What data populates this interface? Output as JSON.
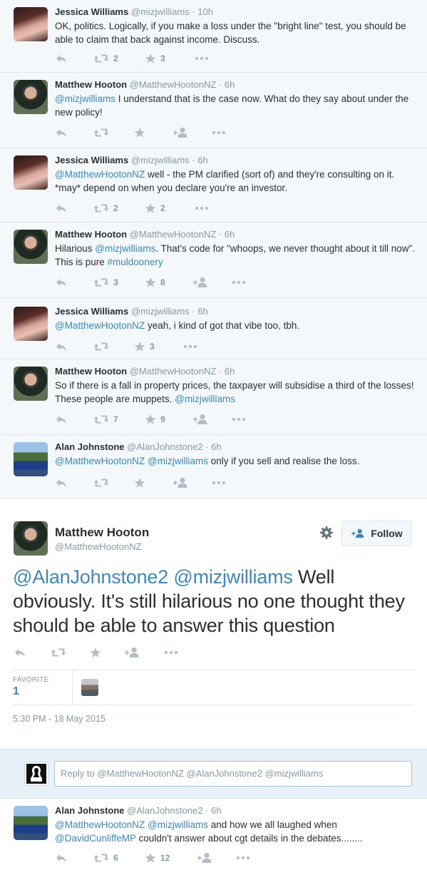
{
  "tweets": [
    {
      "fullname": "Jessica Williams",
      "handle": "@mizjwilliams",
      "time": "· 10h",
      "text_parts": [
        "OK, politics. Logically, if you make a loss under the \"bright line\" test, you should be able to claim that back against income. Discuss."
      ],
      "retweets": "2",
      "favorites": "3",
      "has_follow": false
    },
    {
      "fullname": "Matthew Hooton",
      "handle": "@MatthewHootonNZ",
      "time": "· 6h",
      "mention1": "@mizjwilliams",
      "text": " I understand that is the case now. What do they say about under the new policy!",
      "retweets": "",
      "favorites": "",
      "has_follow": true
    },
    {
      "fullname": "Jessica Williams",
      "handle": "@mizjwilliams",
      "time": "· 6h",
      "mention1": "@MatthewHootonNZ",
      "text": " well - the PM clarified (sort of) and they're consulting on it. *may* depend on when you declare you're an investor.",
      "retweets": "2",
      "favorites": "2",
      "has_follow": false
    },
    {
      "fullname": "Matthew Hooton",
      "handle": "@MatthewHootonNZ",
      "time": "· 6h",
      "pre": "Hilarious ",
      "mention1": "@mizjwilliams",
      "text": ". That's code for \"whoops, we never thought about it till now\". This is pure ",
      "hashtag": "#muldoonery",
      "retweets": "3",
      "favorites": "8",
      "has_follow": true
    },
    {
      "fullname": "Jessica Williams",
      "handle": "@mizjwilliams",
      "time": "· 6h",
      "mention1": "@MatthewHootonNZ",
      "text": " yeah, i kind of got that vibe too, tbh.",
      "retweets": "",
      "favorites": "3",
      "has_follow": false
    },
    {
      "fullname": "Matthew Hooton",
      "handle": "@MatthewHootonNZ",
      "time": "· 6h",
      "text": "So if there is a fall in property prices, the taxpayer will subsidise a third of the losses! These people are muppets. ",
      "mention_end": "@mizjwilliams",
      "retweets": "7",
      "favorites": "9",
      "has_follow": true
    },
    {
      "fullname": "Alan Johnstone",
      "handle": "@AlanJohnstone2",
      "time": "· 6h",
      "mention1": "@MatthewHootonNZ",
      "mention2": "@mizjwilliams",
      "text": " only if you sell and realise the loss.",
      "retweets": "",
      "favorites": "",
      "has_follow": true
    }
  ],
  "main_tweet": {
    "fullname": "Matthew Hooton",
    "handle": "@MatthewHootonNZ",
    "follow_label": "Follow",
    "mention1": "@AlanJohnstone2",
    "mention2": "@mizjwilliams",
    "text": " Well obviously. It's still hilarious no one thought they should be able to answer this question",
    "favorite_label": "FAVORITE",
    "favorite_count": "1",
    "timestamp": "5:30 PM - 18 May 2015"
  },
  "reply_box": {
    "placeholder": "Reply to @MatthewHootonNZ @AlanJohnstone2 @mizjwilliams"
  },
  "last_tweet": {
    "fullname": "Alan Johnstone",
    "handle": "@AlanJohnstone2",
    "time": "· 6h",
    "mention1": "@MatthewHootonNZ",
    "mention2": "@mizjwilliams",
    "text1": " and how we all laughed when ",
    "mention3": "@DavidCunliffeMP",
    "text2": " couldn't answer about cgt details in the debates........",
    "retweets": "6",
    "favorites": "12"
  },
  "colors": {
    "link": "#3b88c3",
    "muted": "#8899a6",
    "icon": "#b3bdc6",
    "border": "#e1e8ed"
  },
  "icons": [
    "reply-icon",
    "retweet-icon",
    "star-icon",
    "follow-icon",
    "more-icon",
    "gear-icon"
  ]
}
